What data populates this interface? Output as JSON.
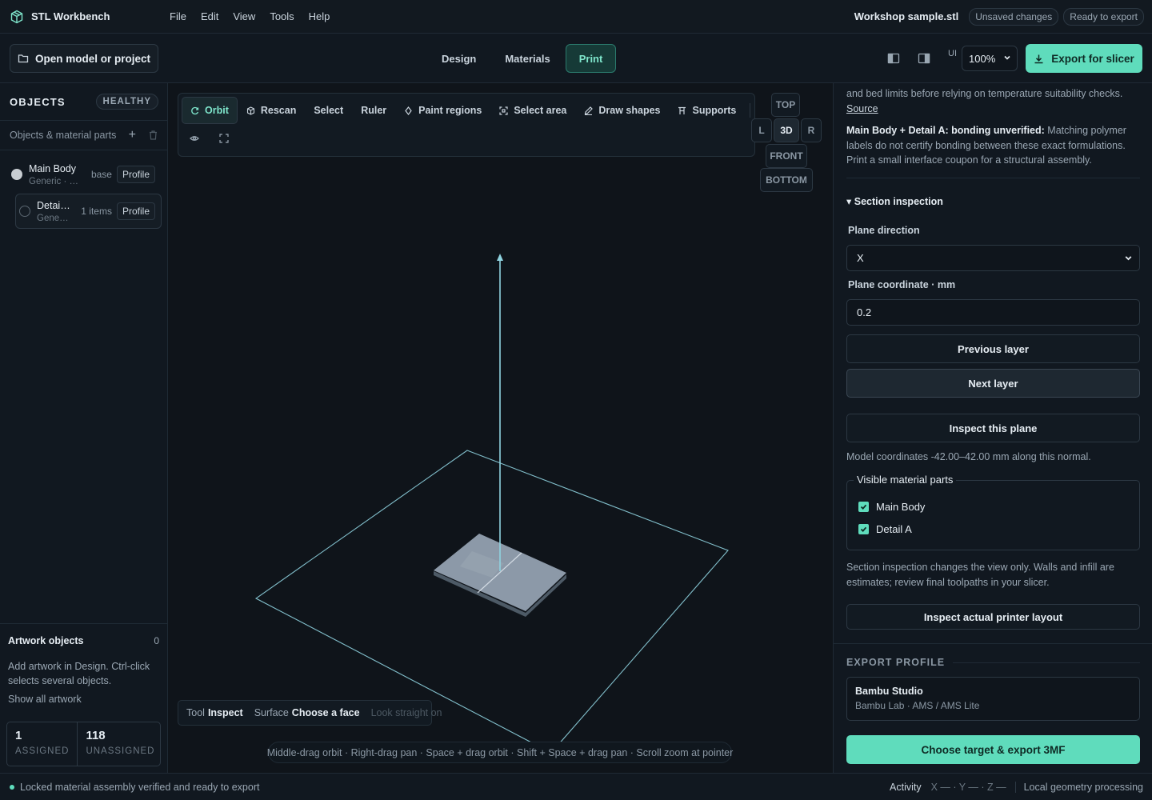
{
  "app": {
    "title": "STL Workbench"
  },
  "menu": [
    "File",
    "Edit",
    "View",
    "Tools",
    "Help"
  ],
  "header": {
    "file_name": "Workshop sample.stl",
    "badges": [
      "Unsaved changes",
      "Ready to export"
    ]
  },
  "toolbar": {
    "open_label": "Open model or project",
    "tabs": [
      "Design",
      "Materials",
      "Print"
    ],
    "active_tab": "Print",
    "ui_label": "UI",
    "zoom": "100%",
    "export_label": "Export for slicer"
  },
  "sidebar": {
    "title": "OBJECTS",
    "health": "HEALTHY",
    "subheader": "Objects & material parts",
    "objects": [
      {
        "name": "Main Body",
        "meta": "Generic · PLA",
        "tag": "base",
        "profile": "Profile"
      },
      {
        "name": "Detail A",
        "meta": "Generic · PLA",
        "tag": "1 items",
        "profile": "Profile"
      }
    ],
    "artwork": {
      "title": "Artwork objects",
      "count": "0",
      "description": "Add artwork in Design. Ctrl-click selects several objects.",
      "link": "Show all artwork",
      "assigned": "1",
      "assigned_label": "ASSIGNED",
      "unassigned": "118",
      "unassigned_label": "UNASSIGNED"
    }
  },
  "tools": [
    "Orbit",
    "Rescan",
    "Select",
    "Ruler",
    "Paint regions",
    "Select area",
    "Draw shapes",
    "Supports"
  ],
  "active_tool": "Orbit",
  "view_buttons": {
    "top": "TOP",
    "left": "L",
    "three_d": "3D",
    "right": "R",
    "front": "FRONT",
    "bottom": "BOTTOM"
  },
  "viewport_status": {
    "tool_key": "Tool",
    "tool_value": "Inspect",
    "surface_key": "Surface",
    "surface_value": "Choose a face",
    "look": "Look straight on"
  },
  "hint": "Middle-drag orbit · Right-drag pan · Space + drag orbit · Shift + Space + drag pan · Scroll zoom at pointer",
  "right_panel": {
    "intro_text": "and bed limits before relying on temperature suitability checks.",
    "source_link": "Source",
    "bond_title": "Main Body + Detail A: bonding unverified:",
    "bond_text": "Matching polymer labels do not certify bonding between these exact formulations. Print a small interface coupon for a structural assembly.",
    "section_title": "▾ Section inspection",
    "plane_direction_label": "Plane direction",
    "plane_direction": "X",
    "plane_coord_label": "Plane coordinate · mm",
    "plane_coord": "0.2",
    "prev_layer": "Previous layer",
    "next_layer": "Next layer",
    "inspect_plane": "Inspect this plane",
    "model_coords": "Model coordinates -42.00–42.00 mm along this normal.",
    "visible_parts_legend": "Visible material parts",
    "visible_parts": [
      "Main Body",
      "Detail A"
    ],
    "section_note": "Section inspection changes the view only. Walls and infill are estimates; review final toolpaths in your slicer.",
    "printer_layout": "Inspect actual printer layout",
    "export_profile_title": "EXPORT PROFILE",
    "profile_name": "Bambu Studio",
    "profile_sub": "Bambu Lab · AMS / AMS Lite",
    "cta": "Choose target & export 3MF"
  },
  "statusbar": {
    "message": "Locked material assembly verified and ready to export",
    "activity": "Activity",
    "coords": "X — · Y — · Z —",
    "processing": "Local geometry processing"
  },
  "colors": {
    "accent": "#5fdcbc",
    "background": "#0f151c",
    "axis": "#8fd3e0"
  }
}
